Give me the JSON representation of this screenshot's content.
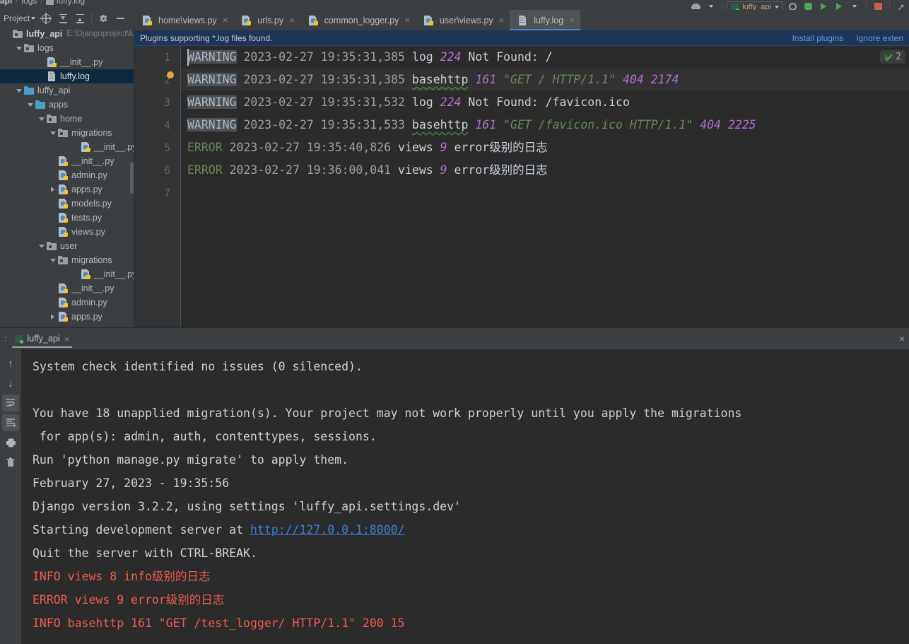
{
  "breadcrumb": {
    "items": [
      "api",
      "logs",
      "luffy.log"
    ],
    "separator": "/"
  },
  "run_toolbar": {
    "config_name": "luffy_api",
    "buttons": [
      {
        "name": "run-with-coverage-button",
        "label": ""
      },
      {
        "name": "debug-button",
        "label": ""
      },
      {
        "name": "run-button",
        "label": ""
      },
      {
        "name": "run-profile-button",
        "label": ""
      },
      {
        "name": "stop-button",
        "label": ""
      }
    ]
  },
  "project_panel": {
    "title": "Project",
    "buttons": [
      {
        "name": "select-opened-file-button",
        "tooltip": "Select Opened File"
      },
      {
        "name": "expand-all-button",
        "tooltip": "Expand All"
      },
      {
        "name": "collapse-all-button",
        "tooltip": "Collapse All"
      },
      {
        "name": "settings-button",
        "tooltip": "Options"
      },
      {
        "name": "hide-button",
        "tooltip": "Hide"
      }
    ],
    "tree": [
      {
        "label": "luffy_api",
        "path": "E:\\Djangoproject\\lu",
        "indent": 0,
        "icon": "folder-grey",
        "twist": "none",
        "bold": true,
        "selected": false
      },
      {
        "label": "logs",
        "path": "",
        "indent": 1,
        "icon": "folder-grey",
        "twist": "open",
        "bold": false,
        "selected": false
      },
      {
        "label": "__init__.py",
        "path": "",
        "indent": 3,
        "icon": "py",
        "twist": "none",
        "bold": false,
        "selected": false
      },
      {
        "label": "luffy.log",
        "path": "",
        "indent": 3,
        "icon": "log",
        "twist": "none",
        "bold": false,
        "selected": true
      },
      {
        "label": "luffy_api",
        "path": "",
        "indent": 1,
        "icon": "folder-blue",
        "twist": "open",
        "bold": false,
        "selected": false
      },
      {
        "label": "apps",
        "path": "",
        "indent": 2,
        "icon": "folder-blue",
        "twist": "open",
        "bold": false,
        "selected": false
      },
      {
        "label": "home",
        "path": "",
        "indent": 3,
        "icon": "folder-grey",
        "twist": "open",
        "bold": false,
        "selected": false
      },
      {
        "label": "migrations",
        "path": "",
        "indent": 4,
        "icon": "folder-grey",
        "twist": "open",
        "bold": false,
        "selected": false
      },
      {
        "label": "__init__.py",
        "path": "",
        "indent": 6,
        "icon": "py",
        "twist": "none",
        "bold": false,
        "selected": false
      },
      {
        "label": "__init__.py",
        "path": "",
        "indent": 4,
        "icon": "py",
        "twist": "none",
        "bold": false,
        "selected": false
      },
      {
        "label": "admin.py",
        "path": "",
        "indent": 4,
        "icon": "py",
        "twist": "none",
        "bold": false,
        "selected": false
      },
      {
        "label": "apps.py",
        "path": "",
        "indent": 4,
        "icon": "py",
        "twist": "closed",
        "bold": false,
        "selected": false
      },
      {
        "label": "models.py",
        "path": "",
        "indent": 4,
        "icon": "py",
        "twist": "none",
        "bold": false,
        "selected": false
      },
      {
        "label": "tests.py",
        "path": "",
        "indent": 4,
        "icon": "py",
        "twist": "none",
        "bold": false,
        "selected": false
      },
      {
        "label": "views.py",
        "path": "",
        "indent": 4,
        "icon": "py",
        "twist": "none",
        "bold": false,
        "selected": false
      },
      {
        "label": "user",
        "path": "",
        "indent": 3,
        "icon": "folder-grey",
        "twist": "open",
        "bold": false,
        "selected": false
      },
      {
        "label": "migrations",
        "path": "",
        "indent": 4,
        "icon": "folder-grey",
        "twist": "open",
        "bold": false,
        "selected": false
      },
      {
        "label": "__init__.py",
        "path": "",
        "indent": 6,
        "icon": "py",
        "twist": "none",
        "bold": false,
        "selected": false
      },
      {
        "label": "__init__.py",
        "path": "",
        "indent": 4,
        "icon": "py",
        "twist": "none",
        "bold": false,
        "selected": false
      },
      {
        "label": "admin.py",
        "path": "",
        "indent": 4,
        "icon": "py",
        "twist": "none",
        "bold": false,
        "selected": false
      },
      {
        "label": "apps.py",
        "path": "",
        "indent": 4,
        "icon": "py",
        "twist": "closed",
        "bold": false,
        "selected": false
      }
    ]
  },
  "editor": {
    "tabs": [
      {
        "label": "home\\views.py",
        "icon": "python-file-icon",
        "active": false
      },
      {
        "label": "urls.py",
        "icon": "python-file-icon",
        "active": false
      },
      {
        "label": "common_logger.py",
        "icon": "python-file-icon",
        "active": false
      },
      {
        "label": "user\\views.py",
        "icon": "python-file-icon",
        "active": false
      },
      {
        "label": "luffy.log",
        "icon": "log-file-icon",
        "active": true
      }
    ],
    "close_glyph": "×",
    "notification": {
      "text": "Plugins supporting *.log files found.",
      "links": [
        "Install plugins",
        "Ignore exten"
      ]
    },
    "line_numbers": [
      "1",
      "2",
      "3",
      "4",
      "5",
      "6",
      "7"
    ],
    "inspection_badge": {
      "count": "2",
      "icon": "inspection-ok-icon"
    },
    "lines": [
      {
        "n": 1,
        "highlight": false,
        "tokens": [
          {
            "t": "WARNING",
            "c": "warn-plain"
          },
          {
            "t": " 2023-02-27 19:35:31,385 ",
            "c": "ts"
          },
          {
            "t": "log ",
            "c": "mod"
          },
          {
            "t": "224",
            "c": "num"
          },
          {
            "t": " Not Found: /",
            "c": "txt"
          }
        ]
      },
      {
        "n": 2,
        "highlight": true,
        "tokens": [
          {
            "t": "WARNING",
            "c": "warn"
          },
          {
            "t": " 2023-02-27 19:35:31,385 ",
            "c": "ts"
          },
          {
            "t": "basehttp",
            "c": "mod-squig"
          },
          {
            "t": " ",
            "c": "txt"
          },
          {
            "t": "161",
            "c": "num"
          },
          {
            "t": " ",
            "c": "txt"
          },
          {
            "t": "\"GET / HTTP/1.1\"",
            "c": "str"
          },
          {
            "t": " ",
            "c": "txt"
          },
          {
            "t": "404 2174",
            "c": "num"
          }
        ]
      },
      {
        "n": 3,
        "highlight": false,
        "tokens": [
          {
            "t": "WARNING",
            "c": "warn"
          },
          {
            "t": " 2023-02-27 19:35:31,532 ",
            "c": "ts"
          },
          {
            "t": "log ",
            "c": "mod"
          },
          {
            "t": "224",
            "c": "num"
          },
          {
            "t": " Not Found: /favicon.ico",
            "c": "txt"
          }
        ]
      },
      {
        "n": 4,
        "highlight": false,
        "tokens": [
          {
            "t": "WARNING",
            "c": "warn"
          },
          {
            "t": " 2023-02-27 19:35:31,533 ",
            "c": "ts"
          },
          {
            "t": "basehttp",
            "c": "mod-squig"
          },
          {
            "t": " ",
            "c": "txt"
          },
          {
            "t": "161",
            "c": "num"
          },
          {
            "t": " ",
            "c": "txt"
          },
          {
            "t": "\"GET /favicon.ico HTTP/1.1\"",
            "c": "str"
          },
          {
            "t": " ",
            "c": "txt"
          },
          {
            "t": "404 2225",
            "c": "num"
          }
        ]
      },
      {
        "n": 5,
        "highlight": false,
        "tokens": [
          {
            "t": "ERROR",
            "c": "err"
          },
          {
            "t": " 2023-02-27 19:35:40,826 ",
            "c": "ts"
          },
          {
            "t": "views ",
            "c": "mod"
          },
          {
            "t": "9",
            "c": "num"
          },
          {
            "t": " error级别的日志",
            "c": "txt"
          }
        ]
      },
      {
        "n": 6,
        "highlight": false,
        "tokens": [
          {
            "t": "ERROR",
            "c": "err"
          },
          {
            "t": " 2023-02-27 19:36:00,041 ",
            "c": "ts"
          },
          {
            "t": "views ",
            "c": "mod"
          },
          {
            "t": "9",
            "c": "num"
          },
          {
            "t": " error级别的日志",
            "c": "txt"
          }
        ]
      },
      {
        "n": 7,
        "highlight": false,
        "tokens": []
      }
    ]
  },
  "run_panel": {
    "tab": {
      "label": "luffy_api",
      "icon": "django-icon"
    },
    "close_glyph": "×",
    "tools": [
      {
        "name": "scroll-up-button",
        "glyph": "↑",
        "pressed": false
      },
      {
        "name": "scroll-down-button",
        "glyph": "↓",
        "pressed": false
      },
      {
        "name": "soft-wrap-button",
        "glyph": "",
        "pressed": true
      },
      {
        "name": "scroll-to-end-button",
        "glyph": "",
        "pressed": true
      },
      {
        "name": "print-button",
        "glyph": "",
        "pressed": false
      },
      {
        "name": "clear-all-button",
        "glyph": "",
        "pressed": false
      }
    ],
    "console_lines": [
      {
        "segments": [
          {
            "t": "System check identified no issues (0 silenced).",
            "c": "plain"
          }
        ]
      },
      {
        "segments": [
          {
            "t": "",
            "c": "plain"
          }
        ]
      },
      {
        "segments": [
          {
            "t": "You have 18 unapplied migration(s). Your project may not work properly until you apply the migrations",
            "c": "plain"
          }
        ]
      },
      {
        "segments": [
          {
            "t": " for app(s): admin, auth, contenttypes, sessions.",
            "c": "plain"
          }
        ]
      },
      {
        "segments": [
          {
            "t": "Run 'python manage.py migrate' to apply them.",
            "c": "plain"
          }
        ]
      },
      {
        "segments": [
          {
            "t": "February 27, 2023 - 19:35:56",
            "c": "plain"
          }
        ]
      },
      {
        "segments": [
          {
            "t": "Django version 3.2.2, using settings 'luffy_api.settings.dev'",
            "c": "plain"
          }
        ]
      },
      {
        "segments": [
          {
            "t": "Starting development server at ",
            "c": "plain"
          },
          {
            "t": "http://127.0.0.1:8000/",
            "c": "link"
          }
        ]
      },
      {
        "segments": [
          {
            "t": "Quit the server with CTRL-BREAK.",
            "c": "plain"
          }
        ]
      },
      {
        "segments": [
          {
            "t": "INFO views 8 info级别的日志",
            "c": "red"
          }
        ]
      },
      {
        "segments": [
          {
            "t": "ERROR views 9 error级别的日志",
            "c": "red"
          }
        ]
      },
      {
        "segments": [
          {
            "t": "INFO basehttp 161 \"GET /test_logger/ HTTP/1.1\" 200 15",
            "c": "red"
          }
        ]
      }
    ]
  },
  "colors": {
    "bg_panel": "#3c3f41",
    "bg_editor": "#2b2b2b",
    "accent_blue": "#4a88c7",
    "notif_bg": "#1d3557",
    "selection": "#0d293e",
    "error_red": "#f05a50",
    "string_green": "#6a8759",
    "number_purple": "#b06fd0"
  }
}
